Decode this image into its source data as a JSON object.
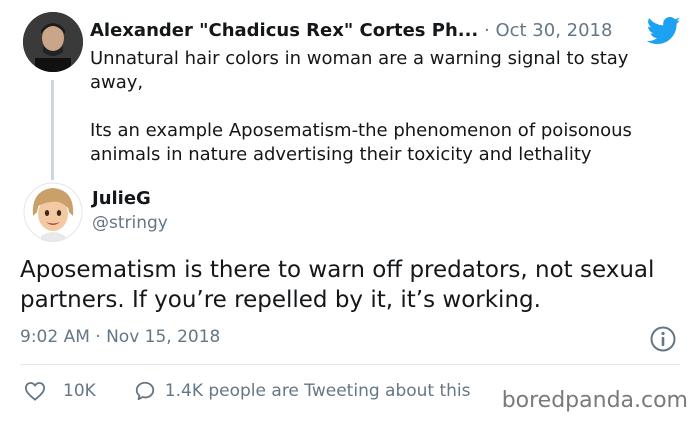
{
  "quoted_tweet": {
    "author_name": "Alexander \"Chadicus Rex\" Cortes Ph...",
    "date": "· Oct 30, 2018",
    "paragraphs": [
      "Unnatural hair colors in woman are a warning signal to stay away,",
      "Its an example Aposematism-the phenomenon of poisonous animals in nature advertising their toxicity and lethality"
    ]
  },
  "reply": {
    "author_name": "JulieG",
    "handle": "@stringy",
    "text": "Aposematism is there to warn off predators, not sexual partners. If you’re repelled by it, it’s working.",
    "timestamp": "9:02 AM · Nov 15, 2018"
  },
  "actions": {
    "likes": "10K",
    "conversation": "1.4K people are Tweeting about this"
  },
  "watermark": "boredpanda.com",
  "colors": {
    "twitter_blue": "#1da1f2",
    "secondary_text": "#657786",
    "primary_text": "#14171a"
  },
  "icons": [
    "twitter-bird-icon",
    "info-icon",
    "heart-icon",
    "speech-bubble-icon"
  ]
}
